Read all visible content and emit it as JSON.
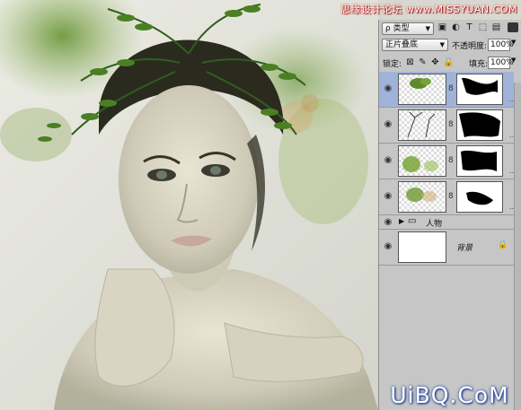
{
  "watermark": "思缘设计论坛 www.MISSYUAN.COM",
  "brand": "UiBQ.CoM",
  "filter": {
    "kind_label": "类型",
    "search_glyph": "ρ"
  },
  "blend": {
    "mode": "正片叠底",
    "opacity_label": "不透明度:",
    "opacity_value": "100%"
  },
  "lock": {
    "label": "锁定:",
    "fill_label": "填充:",
    "fill_value": "100%"
  },
  "filter_icons": [
    "image-filter-icon",
    "adjustment-filter-icon",
    "type-filter-icon",
    "shape-filter-icon",
    "smart-object-filter-icon"
  ],
  "layers": [
    {
      "name": "",
      "active": true,
      "thumb": "fern-top"
    },
    {
      "name": "",
      "active": false,
      "thumb": "branches"
    },
    {
      "name": "",
      "active": false,
      "thumb": "green-splash"
    },
    {
      "name": "",
      "active": false,
      "thumb": "green-small"
    }
  ],
  "group": {
    "name": "人物"
  },
  "background_layer": {
    "name": "背景"
  }
}
